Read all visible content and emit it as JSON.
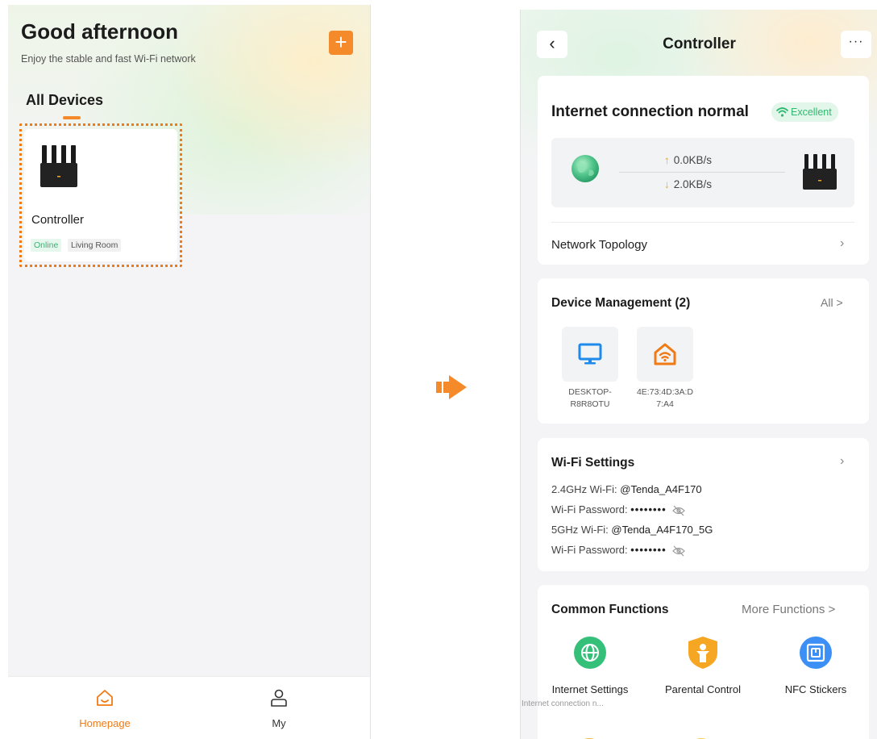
{
  "left_screen": {
    "greeting": "Good afternoon",
    "subtitle": "Enjoy the stable and fast Wi-Fi network",
    "add_icon": "plus-icon",
    "section_title": "All Devices",
    "device": {
      "name": "Controller",
      "status": "Online",
      "location": "Living Room"
    },
    "nav": [
      {
        "label": "Homepage",
        "icon": "home-icon"
      },
      {
        "label": "My",
        "icon": "user-icon"
      }
    ]
  },
  "right_screen": {
    "title": "Controller",
    "back_icon": "chevron-left-icon",
    "more_icon": "more-icon",
    "connection": {
      "status": "Internet connection normal",
      "quality": "Excellent",
      "upload": "0.0KB/s",
      "download": "2.0KB/s"
    },
    "topology_label": "Network Topology",
    "device_management": {
      "title": "Device Management (2)",
      "all_label": "All >",
      "devices": [
        {
          "line1": "DESKTOP-",
          "line2": "R8R8OTU",
          "icon": "desktop-icon"
        },
        {
          "line1": "4E:73:4D:3A:D",
          "line2": "7:A4",
          "icon": "smart-home-icon"
        }
      ]
    },
    "wifi": {
      "title": "Wi-Fi Settings",
      "band24_label": "2.4GHz Wi-Fi:",
      "band24_ssid": "@Tenda_A4F170",
      "password_label": "Wi-Fi Password:",
      "password_mask": "••••••••",
      "band5_label": "5GHz Wi-Fi:",
      "band5_ssid": "@Tenda_A4F170_5G"
    },
    "functions": {
      "title": "Common Functions",
      "more_label": "More Functions >",
      "items": [
        {
          "label": "Internet Settings",
          "sub": "Internet connection n...",
          "icon": "globe-icon",
          "color": "#35c07a"
        },
        {
          "label": "Parental Control",
          "sub": "",
          "icon": "parental-icon",
          "color": "#f5a623"
        },
        {
          "label": "NFC Stickers",
          "sub": "",
          "icon": "nfc-icon",
          "color": "#3b8ff5"
        }
      ]
    }
  },
  "colors": {
    "accent_orange": "#f07a14",
    "online_green": "#2fb870"
  }
}
